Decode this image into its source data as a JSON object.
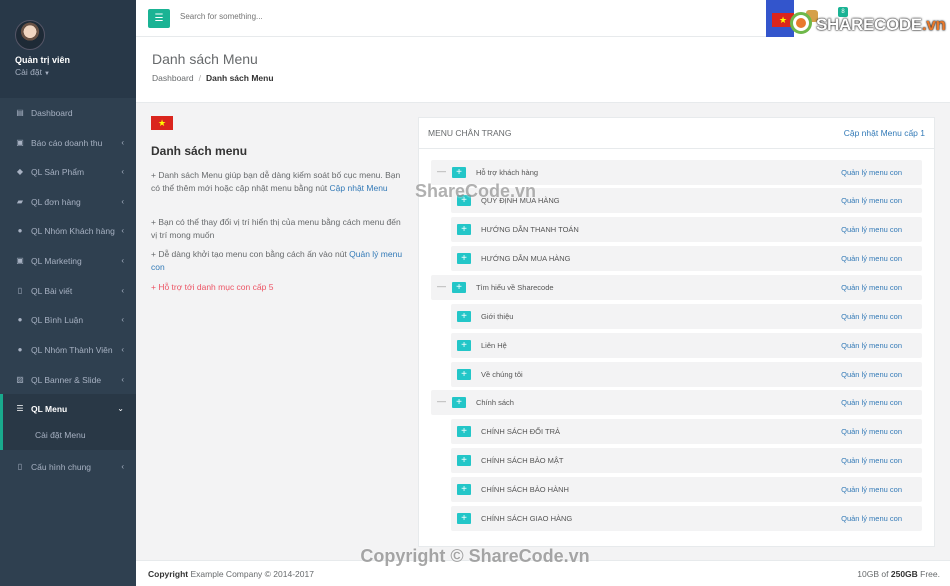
{
  "profile": {
    "name": "Quản trị viên",
    "role": "Cài đặt"
  },
  "sidebar": {
    "items": [
      {
        "label": "Dashboard",
        "icon": "dashboard-icon"
      },
      {
        "label": "Báo cáo doanh thu",
        "icon": "money-icon"
      },
      {
        "label": "QL Sản Phẩm",
        "icon": "cube-icon"
      },
      {
        "label": "QL đơn hàng",
        "icon": "cart-icon"
      },
      {
        "label": "QL Nhóm Khách hàng",
        "icon": "user-icon"
      },
      {
        "label": "QL Marketing",
        "icon": "money-icon"
      },
      {
        "label": "QL Bài viết",
        "icon": "file-icon"
      },
      {
        "label": "QL Bình Luận",
        "icon": "comment-icon"
      },
      {
        "label": "QL Nhóm Thành Viên",
        "icon": "user-icon"
      },
      {
        "label": "QL Banner & Slide",
        "icon": "image-icon"
      },
      {
        "label": "QL Menu",
        "icon": "list-icon"
      },
      {
        "label": "Cấu hình chung",
        "icon": "file-icon"
      }
    ],
    "submenu_label": "Cài đặt Menu"
  },
  "search": {
    "placeholder": "Search for something..."
  },
  "topbar": {
    "badge": "8",
    "logo_main": "SHARECODE",
    "logo_suffix": ".vn"
  },
  "page": {
    "title": "Danh sách Menu",
    "breadcrumb": [
      "Dashboard",
      "Danh sách Menu"
    ]
  },
  "info": {
    "title": "Danh sách menu",
    "p1": "+ Danh sách Menu giúp bạn dễ dàng kiểm soát bố cục menu. Bạn có thể thêm mới hoặc cập nhật menu bằng nút ",
    "p1_link": "Cập nhật Menu",
    "p2": "+ Bạn có thể thay đổi vị trí hiển thị của menu bằng cách menu đến vị trí mong muốn",
    "p3": "+ Dễ dàng khởi tạo menu con bằng cách ấn vào nút ",
    "p3_link": "Quản lý menu con",
    "p4": "+ Hỗ trợ tới danh mục con cấp 5"
  },
  "menu_box": {
    "title": "MENU CHÂN TRANG",
    "update_label": "Cập nhật Menu cấp 1",
    "manage_label": "Quản lý menu con",
    "groups": [
      {
        "label": "Hỗ trợ khách hàng",
        "children": [
          "QUY ĐỊNH MUA HÀNG",
          "HƯỚNG DẪN THANH TOÁN",
          "HƯỚNG DẪN MUA HÀNG"
        ]
      },
      {
        "label": "Tìm hiểu về Sharecode",
        "children": [
          "Giới thiệu",
          "Liên Hệ",
          "Về chúng tôi"
        ]
      },
      {
        "label": "Chính sách",
        "children": [
          "CHÍNH SÁCH ĐỔI TRẢ",
          "CHÍNH SÁCH BẢO MẬT",
          "CHÍNH SÁCH BẢO HÀNH",
          "CHÍNH SÁCH GIAO HÀNG"
        ]
      }
    ]
  },
  "footer": {
    "copyright_bold": "Copyright",
    "copyright_rest": " Example Company © 2014-2017",
    "storage_used": "10GB of ",
    "storage_total": "250GB",
    "storage_suffix": " Free."
  },
  "watermarks": {
    "center": "Copyright © ShareCode.vn",
    "mid": "ShareCode.vn"
  },
  "colors": {
    "sidebar": "#2f4050",
    "accent": "#1ab394",
    "plus": "#23c6c8",
    "link": "#337ab7",
    "red": "#ed5565"
  }
}
